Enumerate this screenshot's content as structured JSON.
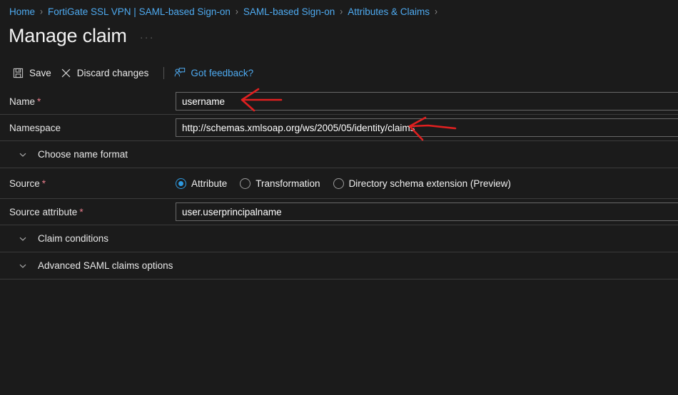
{
  "breadcrumb": {
    "items": [
      {
        "label": "Home"
      },
      {
        "label": "FortiGate SSL VPN | SAML-based Sign-on"
      },
      {
        "label": "SAML-based Sign-on"
      },
      {
        "label": "Attributes & Claims"
      }
    ],
    "separator": "›"
  },
  "header": {
    "title": "Manage claim",
    "more_options": "···"
  },
  "toolbar": {
    "save_label": "Save",
    "discard_label": "Discard changes",
    "feedback_label": "Got feedback?",
    "save_icon": "save-floppy-icon",
    "discard_icon": "close-x-icon",
    "feedback_icon": "feedback-person-icon"
  },
  "form": {
    "name": {
      "label": "Name",
      "required": "*",
      "value": "username"
    },
    "namespace": {
      "label": "Namespace",
      "required": "",
      "value": "http://schemas.xmlsoap.org/ws/2005/05/identity/claims"
    },
    "name_format_section": {
      "label": "Choose name format",
      "chevron": "chevron-down-icon"
    },
    "source": {
      "label": "Source",
      "required": "*",
      "options": [
        {
          "label": "Attribute",
          "checked": true
        },
        {
          "label": "Transformation",
          "checked": false
        },
        {
          "label": "Directory schema extension (Preview)",
          "checked": false
        }
      ]
    },
    "source_attribute": {
      "label": "Source attribute",
      "required": "*",
      "value": "user.userprincipalname"
    },
    "claim_conditions_section": {
      "label": "Claim conditions",
      "chevron": "chevron-down-icon"
    },
    "advanced_section": {
      "label": "Advanced SAML claims options",
      "chevron": "chevron-down-icon"
    }
  },
  "annotations": {
    "arrow_color": "#e02020",
    "arrows": [
      {
        "name": "arrow-pointing-to-name-field"
      },
      {
        "name": "arrow-pointing-to-namespace-field"
      }
    ]
  },
  "colors": {
    "background": "#1b1b1b",
    "link": "#4eaaf0",
    "accent": "#2f9ae0",
    "required": "#e87c8a",
    "divider": "#3b3b3b"
  }
}
